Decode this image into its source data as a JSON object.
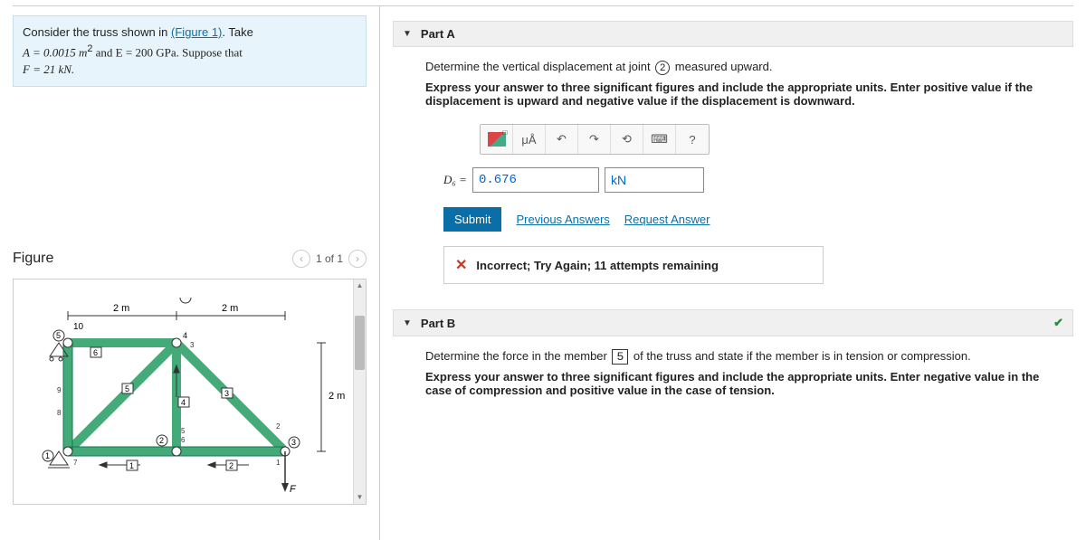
{
  "problem": {
    "intro": "Consider the truss shown in ",
    "figure_link": "(Figure 1)",
    "after_link": ". Take",
    "line2_pre": "A = 0.0015 m",
    "line2_mid": " and E = 200 GPa. Suppose that",
    "line3": "F = 21 kN."
  },
  "figure": {
    "title": "Figure",
    "pager": "1 of 1",
    "labels": {
      "dim_h": "2 m",
      "dim_v": "2 m",
      "force": "F",
      "ten": "10"
    }
  },
  "partA": {
    "title": "Part A",
    "instr1_pre": "Determine the vertical displacement at joint ",
    "instr1_joint": "2",
    "instr1_post": " measured upward.",
    "instr2": "Express your answer to three significant figures and include the appropriate units. Enter positive value if the displacement is upward and negative value if the displacement is downward.",
    "toolbar": {
      "units": "μÅ",
      "help": "?"
    },
    "var_label": "D₆ =",
    "value": "0.676",
    "unit": "kN",
    "submit": "Submit",
    "prev": "Previous Answers",
    "req": "Request Answer",
    "feedback": "Incorrect; Try Again; 11 attempts remaining"
  },
  "partB": {
    "title": "Part B",
    "instr1_pre": "Determine the force in the member ",
    "instr1_member": "5",
    "instr1_post": " of the truss and state if the member is in tension or compression.",
    "instr2": "Express your answer to three significant figures and include the appropriate units. Enter negative value in the case of compression and positive value in the case of tension."
  }
}
